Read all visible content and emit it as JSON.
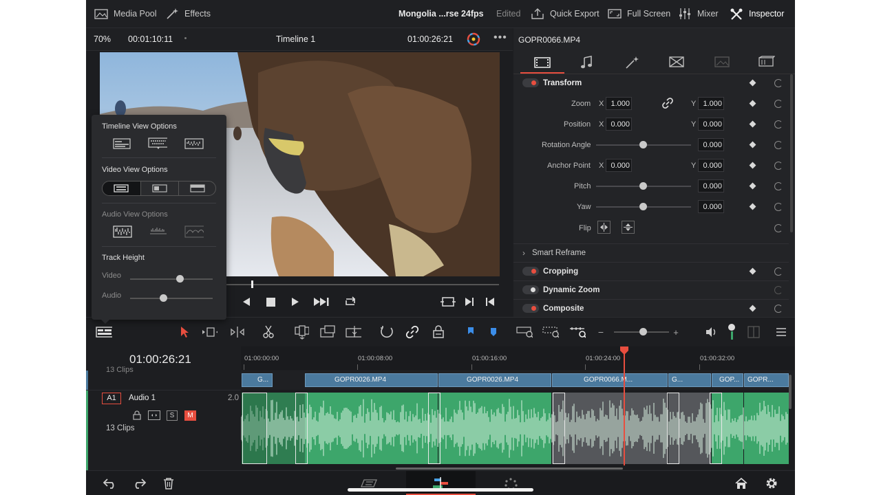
{
  "topbar": {
    "media_pool": "Media Pool",
    "effects": "Effects",
    "project_title": "Mongolia ...rse 24fps",
    "edited": "Edited",
    "quick_export": "Quick Export",
    "full_screen": "Full Screen",
    "mixer": "Mixer",
    "inspector": "Inspector"
  },
  "viewer": {
    "zoom": "70%",
    "source_tc": "00:01:10:11",
    "timeline_name": "Timeline 1",
    "record_tc": "01:00:26:21"
  },
  "inspector": {
    "clip_name": "GOPR0066.MP4",
    "transform_title": "Transform",
    "zoom_label": "Zoom",
    "zoom_x": "1.000",
    "zoom_y": "1.000",
    "position_label": "Position",
    "position_x": "0.000",
    "position_y": "0.000",
    "rotation_label": "Rotation Angle",
    "rotation_value": "0.000",
    "anchor_label": "Anchor Point",
    "anchor_x": "0.000",
    "anchor_y": "0.000",
    "pitch_label": "Pitch",
    "pitch_value": "0.000",
    "yaw_label": "Yaw",
    "yaw_value": "0.000",
    "flip_label": "Flip",
    "x_label": "X",
    "y_label": "Y",
    "smart_reframe": "Smart Reframe",
    "cropping": "Cropping",
    "dynamic_zoom": "Dynamic Zoom",
    "composite": "Composite"
  },
  "popup": {
    "timeline_view": "Timeline View Options",
    "video_view": "Video View Options",
    "audio_view": "Audio View Options",
    "track_height": "Track Height",
    "video_label": "Video",
    "audio_label": "Audio",
    "video_height_level": 0.6,
    "audio_height_level": 0.4
  },
  "timeline": {
    "timecode": "01:00:26:21",
    "ruler_labels": [
      "01:00:00:00",
      "01:00:08:00",
      "01:00:16:00",
      "01:00:24:00",
      "01:00:32:00"
    ],
    "video_clips": [
      "G...",
      "GOPR0026.MP4",
      "GOPR0026.MP4",
      "GOPR0066.M...",
      "G...",
      "GOP...",
      "GOPR..."
    ],
    "audio_track_id": "A1",
    "audio_track_name": "Audio 1",
    "audio_track_level": "2.0",
    "clip_count": "13 Clips",
    "solo": "S",
    "mute": "M",
    "video_clip_count_partial": "13 Clips"
  },
  "colors": {
    "accent_red": "#e84e3f",
    "audio_green": "#3da66b",
    "video_blue": "#4b7a9e",
    "playhead": "#e84e3f"
  }
}
